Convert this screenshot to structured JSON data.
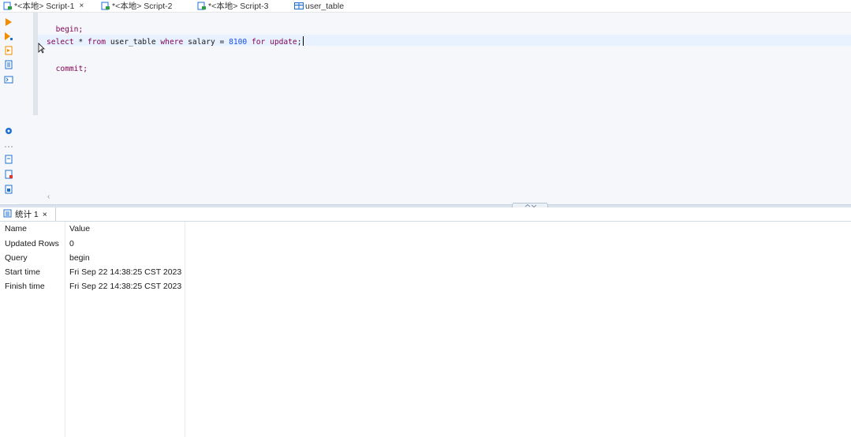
{
  "tabs": [
    {
      "label": "*<本地> Script-1",
      "active": true,
      "closable": true,
      "icon": "sql-script-icon"
    },
    {
      "label": "*<本地> Script-2",
      "active": false,
      "closable": false,
      "icon": "sql-script-icon"
    },
    {
      "label": "*<本地> Script-3",
      "active": false,
      "closable": false,
      "icon": "sql-script-icon"
    },
    {
      "label": "user_table",
      "active": false,
      "closable": false,
      "icon": "table-icon"
    }
  ],
  "editor": {
    "lines": [
      {
        "text": "begin;"
      },
      {
        "text": "select * from user_table where salary = 8100 for update;"
      },
      {
        "text": "commit;"
      }
    ],
    "tokens_line2": {
      "select": "select",
      "star": " * ",
      "from": "from",
      "table": " user_table ",
      "where": "where",
      "col": " salary = ",
      "value": "8100",
      "for": " for",
      "update": " update",
      "semi": ";"
    },
    "scroll_left_glyph": "‹"
  },
  "results": {
    "tab_label": "统计 1",
    "close_glyph": "×",
    "columns": [
      "Name",
      "Value"
    ],
    "rows": [
      {
        "name": "Updated Rows",
        "value": "0"
      },
      {
        "name": "Query",
        "value": "begin"
      },
      {
        "name": "Start time",
        "value": "Fri Sep 22 14:38:25 CST 2023"
      },
      {
        "name": "Finish time",
        "value": "Fri Sep 22 14:38:25 CST 2023"
      }
    ]
  },
  "colors": {
    "accent": "#1f6fd1",
    "run_orange": "#f28c00",
    "keyword": "#7f0055",
    "number": "#1750eb"
  }
}
